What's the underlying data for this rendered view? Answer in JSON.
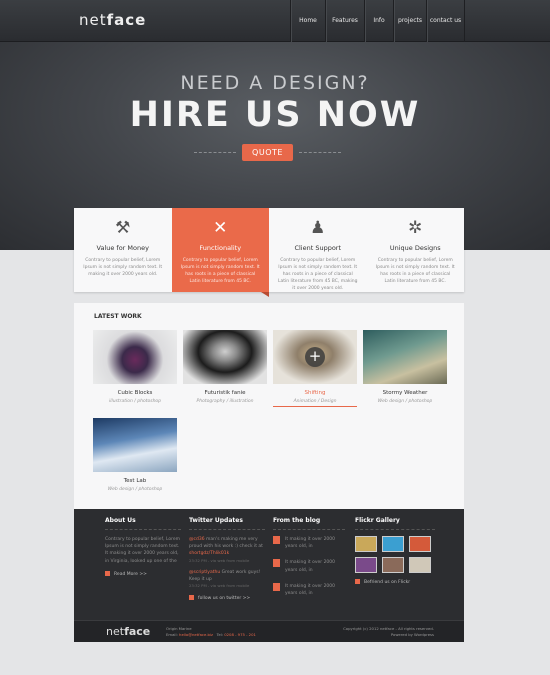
{
  "header": {
    "logo_light": "net",
    "logo_bold": "face",
    "nav": [
      "Home",
      "Features",
      "Info",
      "projects",
      "contact us"
    ]
  },
  "hero": {
    "subtitle": "NEED A DESIGN?",
    "title": "HIRE US NOW",
    "button": "QUOTE"
  },
  "features": [
    {
      "icon": "tools-icon",
      "title": "Value for Money",
      "text": "Contrary to popular belief, Lorem Ipsum is not simply random text. It making it over 2000 years old."
    },
    {
      "icon": "tools-icon",
      "title": "Functionality",
      "text": "Contrary to popular belief, Lorem Ipsum is not simply random text. It has roots in a piece of classical Latin literature from 45 BC."
    },
    {
      "icon": "users-icon",
      "title": "Client Support",
      "text": "Contrary to popular belief, Lorem Ipsum is not simply random text. It has roots in a piece of classical Latin literature from 45 BC, making it over 2000 years old."
    },
    {
      "icon": "gear-icon",
      "title": "Unique Designs",
      "text": "Contrary to popular belief, Lorem Ipsum is not simply random text. It has roots in a piece of classical Latin literature from 45 BC."
    }
  ],
  "work": {
    "heading": "LATEST WORK",
    "items": [
      {
        "name": "Cubic Blocks",
        "category": "illustration / photoshop"
      },
      {
        "name": "Futuristik fanie",
        "category": "Photography / illustration"
      },
      {
        "name": "Shifting",
        "category": "Animation / Design"
      },
      {
        "name": "Stormy Weather",
        "category": "Web design / photoshop"
      },
      {
        "name": "Test Lab",
        "category": "Web design / photoshop"
      }
    ]
  },
  "footer": {
    "about": {
      "heading": "About Us",
      "text": "Contrary to popular belief, Lorem Ipsum is not simply random text. It making it over 2000 years old, in Virginia, looked up one of the",
      "more": "Read More >>"
    },
    "twitter": {
      "heading": "Twitter Updates",
      "tweets": [
        {
          "user": "@cd36",
          "text": "man's making me very proud with his work :) check it at",
          "link": "shortgdz/Thlik01k",
          "meta": "23:32 PM - via web from mobile"
        },
        {
          "user": "@scriptlyathu",
          "text": "Great work guys! Keep it up",
          "meta": "23:32 PM - via web from mobile"
        }
      ],
      "follow": "follow us on twitter >>"
    },
    "blog": {
      "heading": "From the blog",
      "posts": [
        "It making it over 2000 years old, in",
        "It making it over 2000 years old, in",
        "It making it over 2000 years old, in"
      ]
    },
    "flickr": {
      "heading": "Flickr Gallery",
      "follow": "Befriend us on Flickr"
    }
  },
  "bottom": {
    "logo_light": "net",
    "logo_bold": "face",
    "company": "Origin Marine",
    "email_label": "Email:",
    "email": "hello@netface.biz",
    "tel_label": "Tel:",
    "tel": "0208 - 975 - 201",
    "copyright": "Copyright (c) 2012 netface - All rights reserved.",
    "powered": "Powered by Wordpress"
  },
  "colors": {
    "accent": "#e8684a",
    "dark": "#2c2d30"
  }
}
